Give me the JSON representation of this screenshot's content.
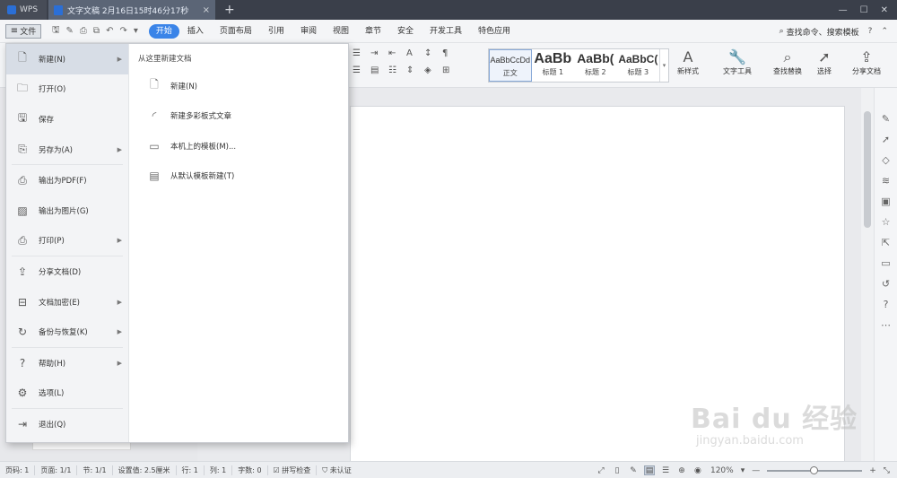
{
  "titlebar": {
    "app_tab": "WPS",
    "doc_tab": "文字文稿 2月16日15时46分17秒",
    "close_glyph": "×",
    "new_tab_glyph": "+"
  },
  "menubar": {
    "file_label": "文件",
    "tabs": [
      "开始",
      "插入",
      "页面布局",
      "引用",
      "审阅",
      "视图",
      "章节",
      "安全",
      "开发工具",
      "特色应用"
    ],
    "search_label": "查找命令、搜索模板"
  },
  "toolbar": {
    "styles": [
      {
        "preview": "AaBbCcDd",
        "name": "正文"
      },
      {
        "preview": "AaBb",
        "name": "标题 1"
      },
      {
        "preview": "AaBb(",
        "name": "标题 2"
      },
      {
        "preview": "AaBbC(",
        "name": "标题 3"
      }
    ],
    "new_style": "新样式",
    "text_tools": "文字工具",
    "find_replace": "查找替换",
    "select": "选择",
    "share_doc": "分享文档"
  },
  "file_menu": {
    "items": [
      {
        "label": "新建(N)",
        "icon": "new-doc-icon",
        "arrow": true
      },
      {
        "label": "打开(O)",
        "icon": "folder-icon",
        "arrow": false
      },
      {
        "label": "保存",
        "icon": "save-icon",
        "arrow": false
      },
      {
        "label": "另存为(A)",
        "icon": "save-as-icon",
        "arrow": true
      },
      {
        "label": "输出为PDF(F)",
        "icon": "pdf-icon",
        "arrow": false
      },
      {
        "label": "输出为图片(G)",
        "icon": "image-icon",
        "arrow": false
      },
      {
        "label": "打印(P)",
        "icon": "printer-icon",
        "arrow": true
      },
      {
        "label": "分享文档(D)",
        "icon": "share-icon",
        "arrow": false
      },
      {
        "label": "文档加密(E)",
        "icon": "encrypt-icon",
        "arrow": true
      },
      {
        "label": "备份与恢复(K)",
        "icon": "backup-icon",
        "arrow": true
      },
      {
        "label": "帮助(H)",
        "icon": "help-icon",
        "arrow": true
      },
      {
        "label": "选项(L)",
        "icon": "gear-icon",
        "arrow": false
      },
      {
        "label": "退出(Q)",
        "icon": "exit-icon",
        "arrow": false
      }
    ],
    "submenu_header": "从这里新建文档",
    "submenu": [
      {
        "label": "新建(N)",
        "icon": "new-blank-icon"
      },
      {
        "label": "新建多彩板式文章",
        "icon": "colorful-article-icon"
      },
      {
        "label": "本机上的模板(M)...",
        "icon": "local-template-icon"
      },
      {
        "label": "从默认模板新建(T)",
        "icon": "default-template-icon"
      }
    ]
  },
  "statusbar": {
    "page_num": "页码: 1",
    "pages": "页面: 1/1",
    "section": "节: 1/1",
    "setting": "设置值: 2.5厘米",
    "row": "行: 1",
    "col": "列: 1",
    "words": "字数: 0",
    "spell": "拼写检查",
    "cert": "未认证",
    "zoom": "120%",
    "zoom_level": 0.5
  },
  "watermark": {
    "line1": "Bai du 经验",
    "line2": "jingyan.baidu.com"
  }
}
